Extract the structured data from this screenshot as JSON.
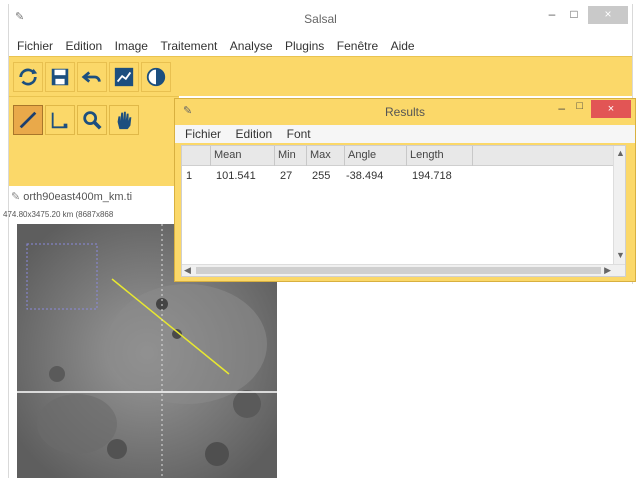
{
  "main": {
    "title": "Salsal",
    "window_controls": {
      "minimize": "–",
      "maximize": "□",
      "close": "×"
    }
  },
  "menu": [
    "Fichier",
    "Edition",
    "Image",
    "Traitement",
    "Analyse",
    "Plugins",
    "Fenêtre",
    "Aide"
  ],
  "toolbar": {
    "icons": [
      "refresh-icon",
      "save-icon",
      "undo-icon",
      "chart-icon",
      "contrast-icon"
    ]
  },
  "tools": {
    "icons": [
      "line-tool-icon",
      "rectangle-tool-icon",
      "zoom-icon",
      "hand-icon"
    ]
  },
  "image": {
    "title": "orth90east400m_km.ti",
    "subtitle": "474.80x3475.20 km (8687x868"
  },
  "results": {
    "title": "Results",
    "menu": [
      "Fichier",
      "Edition",
      "Font"
    ],
    "columns": [
      "Mean",
      "Min",
      "Max",
      "Angle",
      "Length"
    ],
    "row": {
      "index": "1",
      "mean": "101.541",
      "min": "27",
      "max": "255",
      "angle": "-38.494",
      "length": "194.718"
    }
  }
}
